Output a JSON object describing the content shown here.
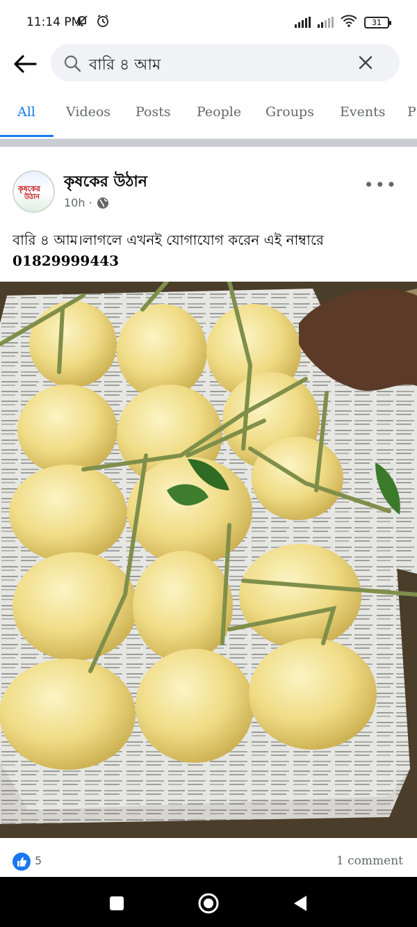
{
  "status_bar": {
    "time": "11:14 PM",
    "battery": "31",
    "icons": [
      "mute-icon",
      "alarm-icon",
      "signal-icon",
      "signal-icon",
      "wifi-icon",
      "battery-icon"
    ]
  },
  "search": {
    "query": "বারি ৪ আম",
    "back_icon": "arrow-left-icon",
    "search_icon": "search-icon",
    "clear_icon": "close-icon"
  },
  "tabs": [
    {
      "label": "All",
      "active": true
    },
    {
      "label": "Videos",
      "active": false
    },
    {
      "label": "Posts",
      "active": false
    },
    {
      "label": "People",
      "active": false
    },
    {
      "label": "Groups",
      "active": false
    },
    {
      "label": "Events",
      "active": false
    },
    {
      "label": "P",
      "active": false
    }
  ],
  "post": {
    "page_name": "কৃষকের উঠান",
    "avatar_text_line1": "কৃষকের",
    "avatar_text_line2": "উঠান",
    "time": "10h ·",
    "privacy_icon": "globe-icon",
    "more_icon": "more-dots-icon",
    "text": "বারি ৪ আম।লাগলে এখনই যোগাযোগ করেন এই নাম্বারে",
    "phone": "01829999443",
    "image_description_icon": "mango-photo",
    "likes": "5",
    "comments": "1 comment"
  },
  "colors": {
    "accent": "#1877f2",
    "text_secondary": "#65676b",
    "search_bg": "#f0f2f5"
  },
  "nav": {
    "icons": [
      "recents-square-icon",
      "home-circle-icon",
      "back-triangle-icon"
    ]
  }
}
